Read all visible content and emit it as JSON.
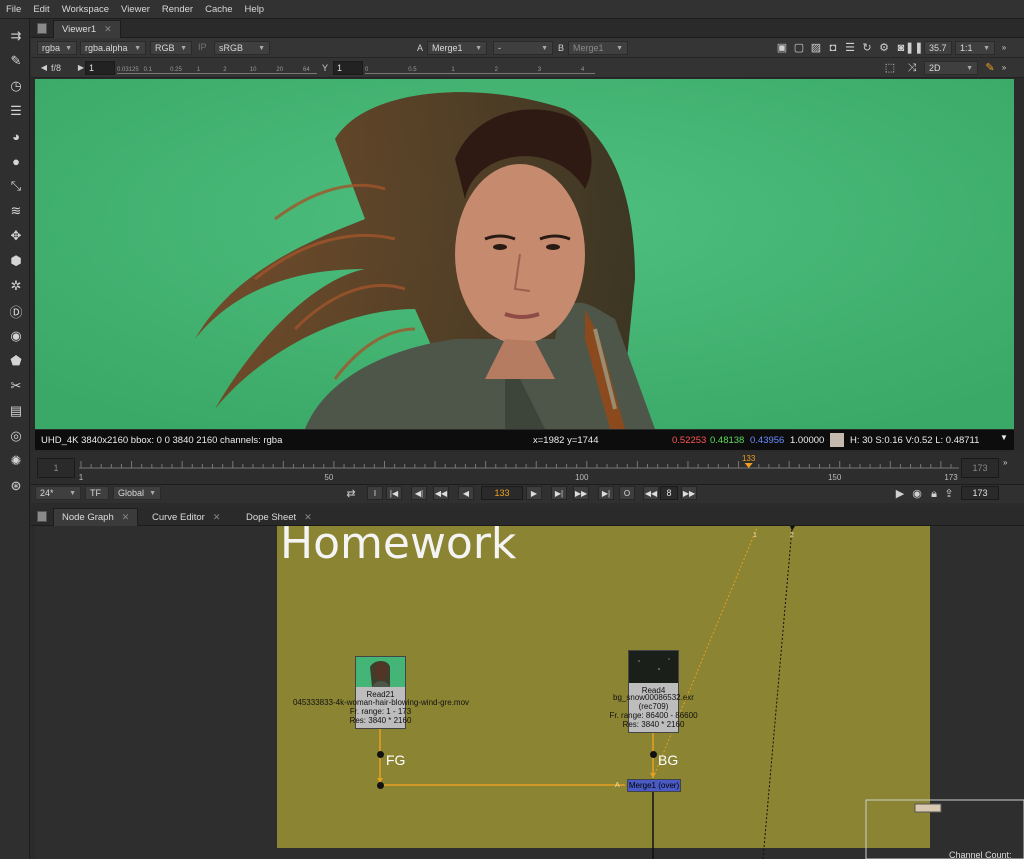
{
  "menu": [
    "File",
    "Edit",
    "Workspace",
    "Viewer",
    "Render",
    "Cache",
    "Help"
  ],
  "tabs_top": [
    {
      "label": "Viewer1",
      "close": "✕"
    }
  ],
  "viewer_bar": {
    "channels": "rgba",
    "alpha": "rgba.alpha",
    "display": "RGB",
    "ip": "IP",
    "lut": "sRGB",
    "a_label": "A",
    "a_input": "Merge1",
    "mid": "-",
    "b_label": "B",
    "b_input": "Merge1",
    "zoom": "35.7",
    "ratio": "1:1"
  },
  "viewer_bar2": {
    "fstop": "f/8",
    "gain": "1",
    "y_label": "Y",
    "gamma": "1",
    "view_mode": "2D",
    "gain_ticks": [
      "0.03125",
      "0.1",
      "0.25",
      "1",
      "2",
      "10",
      "20",
      "64"
    ],
    "gamma_ticks": [
      "0",
      "0.5",
      "1",
      "2",
      "3",
      "4"
    ]
  },
  "info": {
    "format": "UHD_4K 3840x2160  bbox: 0 0 3840 2160 channels: rgba",
    "coords": "x=1982 y=1744",
    "r": "0.52253",
    "g": "0.48138",
    "b": "0.43956",
    "a": "1.00000",
    "hsvl": "H: 30 S:0.16 V:0.52  L: 0.48711",
    "colors": {
      "r": "#ff5555",
      "g": "#5ddc5d",
      "b": "#6a8cff",
      "a": "#ffffff",
      "swatch": "#c4b9ad"
    }
  },
  "timeline": {
    "start": "1",
    "end": "173",
    "current": "133",
    "ticks": [
      "1",
      "50",
      "100",
      "150",
      "173"
    ]
  },
  "playbar": {
    "fps": "24*",
    "tf": "TF",
    "scope": "Global",
    "frame": "133",
    "step": "8",
    "end": "173",
    "buttons": [
      "I",
      "|◀",
      "◀|",
      "◀◀",
      "◀",
      "▶",
      "▶|",
      "▶▶",
      "▶|",
      "O"
    ]
  },
  "tabs_bottom": [
    {
      "label": "Node Graph",
      "close": "✕"
    },
    {
      "label": "Curve Editor",
      "close": "✕"
    },
    {
      "label": "Dope Sheet",
      "close": "✕"
    }
  ],
  "graph": {
    "backdrop_title": "Homework",
    "read21": {
      "name": "Read21",
      "file": "045333833-4k-woman-hair-blowing-wind-gre.mov",
      "range": "Fr. range: 1 - 173",
      "res": "Res: 3840 * 2160"
    },
    "read4": {
      "name": "Read4",
      "file": "bg_snow00086532.exr",
      "colorspace": "(rec709)",
      "range": "Fr. range: 86400 - 86600",
      "res": "Res: 3840 * 2160"
    },
    "fg_label": "FG",
    "bg_label": "BG",
    "merge": "Merge1 (over)",
    "merge_a": "A",
    "pipe_labels": [
      "1",
      "2"
    ],
    "status": "Channel Count:"
  }
}
